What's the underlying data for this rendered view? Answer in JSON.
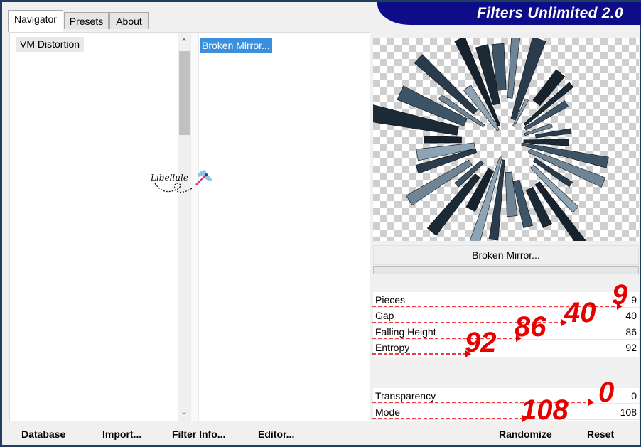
{
  "window": {
    "brand": "Filters Unlimited 2.0"
  },
  "tabs": [
    {
      "label": "Navigator",
      "active": true
    },
    {
      "label": "Presets",
      "active": false
    },
    {
      "label": "About",
      "active": false
    }
  ],
  "categories": {
    "selected": "VM Distortion"
  },
  "filters": {
    "selected": "Broken Mirror..."
  },
  "watermark": {
    "text": "Libellule"
  },
  "preview": {
    "filter_name": "Broken Mirror..."
  },
  "params": {
    "group1": [
      {
        "label": "Pieces",
        "value": "9"
      },
      {
        "label": "Gap",
        "value": "40"
      },
      {
        "label": "Falling Height",
        "value": "86"
      },
      {
        "label": "Entropy",
        "value": "92"
      }
    ],
    "group2": [
      {
        "label": "Transparency",
        "value": "0"
      },
      {
        "label": "Mode",
        "value": "108"
      }
    ]
  },
  "buttons": {
    "database": "Database",
    "import": "Import...",
    "filter_info": "Filter Info...",
    "editor": "Editor...",
    "randomize": "Randomize",
    "reset": "Reset"
  },
  "annotations": {
    "pieces": "9",
    "gap": "40",
    "falling_height": "86",
    "entropy": "92",
    "transparency": "0",
    "mode": "108",
    "color": "#e60000"
  },
  "colors": {
    "brand_bg": "#0d0d8a",
    "selection": "#3b8fdc",
    "annotation": "#e60000"
  }
}
